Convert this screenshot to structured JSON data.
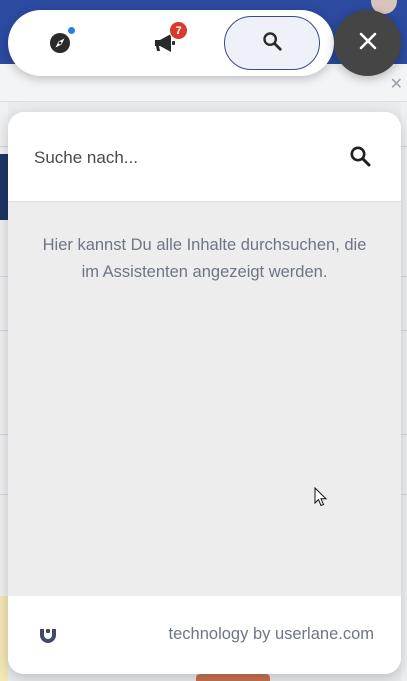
{
  "launcher": {
    "explore_icon": "compass-icon",
    "explore_has_dot": true,
    "announcements_icon": "megaphone-icon",
    "announcements_count": "7",
    "search_icon": "search-icon",
    "close_icon": "close-icon"
  },
  "search": {
    "placeholder": "Suche nach...",
    "value": ""
  },
  "info": {
    "text": "Hier kannst Du alle Inhalte durchsuchen, die im Assistenten angezeigt werden."
  },
  "footer": {
    "text": "technology by userlane.com",
    "logo_icon": "userlane-logo-icon"
  },
  "colors": {
    "accent_blue": "#2f7ce0",
    "badge_red": "#d83a2b",
    "close_dark": "#454545",
    "text_muted": "#6e7585",
    "header_blue": "#2b4aa0"
  }
}
